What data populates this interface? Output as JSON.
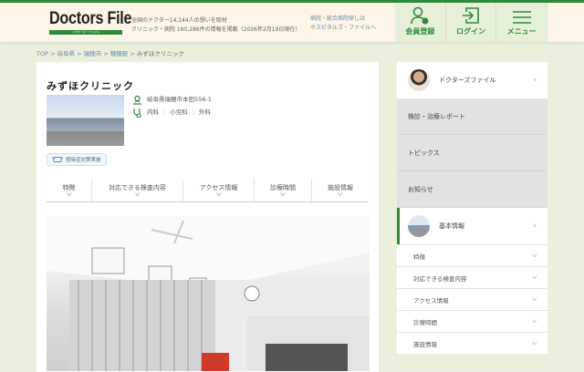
{
  "header": {
    "logo": "Doctors File",
    "logo_sub": "ドクターズ・ファイル",
    "desc_line1": "全国のドクター14,144人の想いを取材",
    "desc_line2": "クリニック・病院 160,286件の情報を掲載（2026年2月19日現在）",
    "hospital_link_line1": "病院・総合病院探しは",
    "hospital_link_line2": "ホスピタルズ・ファイルへ",
    "buttons": [
      {
        "label": "会員登録",
        "icon": "user-plus-icon"
      },
      {
        "label": "ログイン",
        "icon": "login-icon"
      },
      {
        "label": "メニュー",
        "icon": "menu-icon"
      }
    ]
  },
  "breadcrumb": [
    "TOP",
    "岐阜県",
    "瑞穂市",
    "穂積駅",
    "みずほクリニック"
  ],
  "clinic": {
    "name": "みずほクリニック",
    "address": "岐阜県瑞穂市本田556-1",
    "departments": [
      "内科",
      "小児科",
      "外科"
    ],
    "badge": "感染症対策実施"
  },
  "tabs": [
    "特徴",
    "対応できる検査内容",
    "アクセス情報",
    "診療時間",
    "施設情報"
  ],
  "sidebar": {
    "doctor": "ドクターズファイル",
    "items": [
      "検診・治療レポート",
      "トピックス",
      "お知らせ"
    ],
    "basic": "基本情報",
    "sub": [
      "特徴",
      "対応できる検査内容",
      "アクセス情報",
      "診療時間",
      "施設情報"
    ]
  }
}
